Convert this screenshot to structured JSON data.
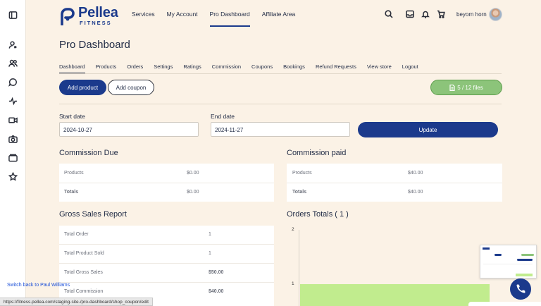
{
  "header": {
    "logo_name": "Pellea",
    "logo_sub": "FITNESS",
    "nav": [
      "Services",
      "My Account",
      "Pro Dashboard",
      "Affiliate Area"
    ],
    "active_nav": "Pro Dashboard",
    "user_name": "beyorn horn"
  },
  "page": {
    "title": "Pro Dashboard"
  },
  "subnav": [
    "Dashboard",
    "Products",
    "Orders",
    "Settings",
    "Ratings",
    "Commission",
    "Coupons",
    "Bookings",
    "Refund Requests",
    "View store",
    "Logout"
  ],
  "actions": {
    "add_product": "Add product",
    "add_coupon": "Add coupon",
    "files": "5 / 12 files"
  },
  "dates": {
    "start_label": "Start date",
    "start_value": "2024-10-27",
    "end_label": "End date",
    "end_value": "2024-11-27",
    "update": "Update"
  },
  "commission_due": {
    "title": "Commission Due",
    "rows": [
      {
        "label": "Products",
        "value": "$0.00"
      },
      {
        "label": "Totals",
        "value": "$0.00"
      }
    ]
  },
  "commission_paid": {
    "title": "Commission paid",
    "rows": [
      {
        "label": "Products",
        "value": "$40.00"
      },
      {
        "label": "Totals",
        "value": "$40.00"
      }
    ]
  },
  "gross_sales": {
    "title": "Gross Sales Report",
    "rows": [
      {
        "label": "Total Order",
        "value": "1"
      },
      {
        "label": "Total Product Sold",
        "value": "1"
      },
      {
        "label": "Total Gross Sales",
        "value": "$50.00"
      },
      {
        "label": "Total Commission",
        "value": "$40.00"
      }
    ]
  },
  "orders_totals": {
    "title": "Orders Totals ( 1 )"
  },
  "chart_data": {
    "type": "bar",
    "title": "Orders Totals ( 1 )",
    "yticks": [
      "2",
      "1"
    ],
    "ylim": [
      0,
      2
    ],
    "values": [
      1
    ]
  },
  "footer": {
    "switch_back": "Switch back to Paul Williams",
    "status_url": "https://fitness.pellea.com/staging-site-/pro-dashboard/shop_coupon/edit"
  }
}
